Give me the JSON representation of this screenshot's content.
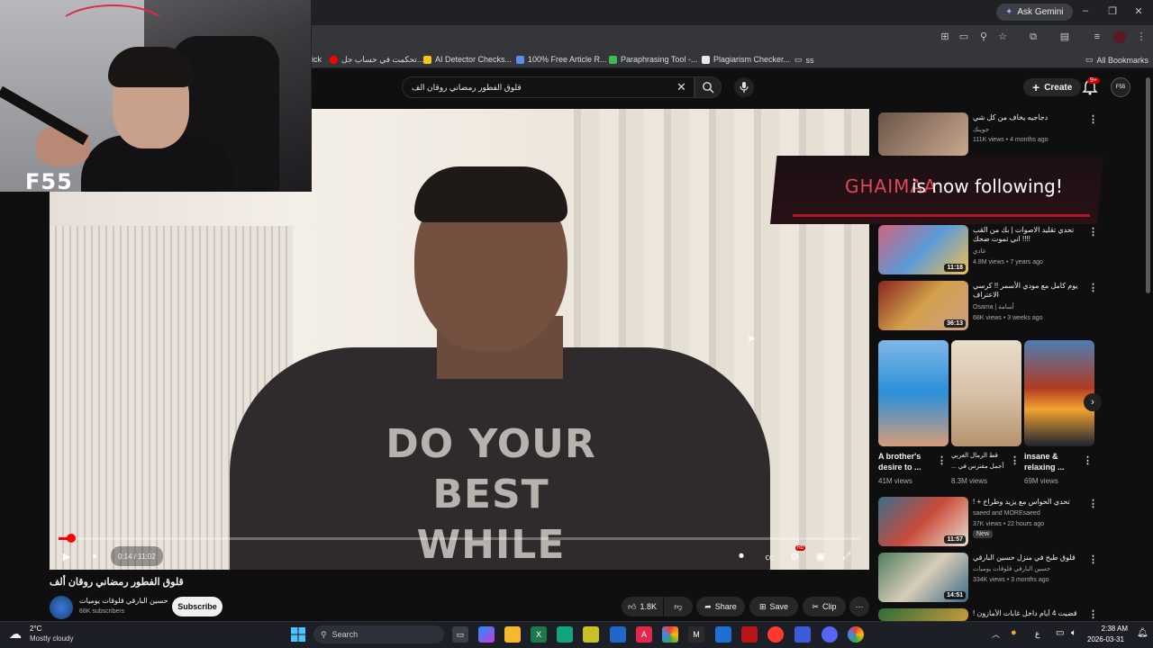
{
  "browser": {
    "ask_gemini": "Ask Gemini",
    "bookmarks": [
      {
        "label": "ick",
        "color": "#202124"
      },
      {
        "label": "تحكمت في حساب جل...",
        "color": "#ff0000"
      },
      {
        "label": "AI Detector Checks...",
        "color": "#f5c518"
      },
      {
        "label": "100% Free Article R...",
        "color": "#5b8def"
      },
      {
        "label": "Paraphrasing Tool -...",
        "color": "#3cba54"
      },
      {
        "label": "Plagiarism Checker...",
        "color": "#e8eaed"
      },
      {
        "label": "ss",
        "color": "#9aa0a6"
      }
    ],
    "all_bookmarks": "All Bookmarks"
  },
  "youtube": {
    "search_query": "قلوق الفطور رمضاني روقان الف",
    "create_label": "Create",
    "notification_count": "9+",
    "avatar_text": "F55"
  },
  "video": {
    "title": "قلوق الفطور رمضاني روقان ألف",
    "time": "0:14 / 11:02",
    "progress": 0.02,
    "shirt_text": [
      "DO YOUR",
      "BEST",
      "WHILE"
    ],
    "channel_name": "حسين البارقي قلوقات يوميات",
    "subscribers": "68K subscribers",
    "subscribe_label": "Subscribe",
    "likes": "1.8K",
    "share_label": "Share",
    "save_label": "Save",
    "clip_label": "Clip"
  },
  "follow_alert": {
    "name": "GHAIMAA",
    "text": "is now following!"
  },
  "sidebar": {
    "videos": [
      {
        "title": "دجاجيه يخاف من كل شي",
        "channel": "جوينك",
        "meta": "111K views • 4 months ago",
        "duration": "",
        "color": "#6a5548"
      },
      {
        "title": "تحدي تقليد الاصوات | بك من القب !!!! اني تموت ضحك",
        "channel": "عادي",
        "meta": "4.8M views • 7 years ago",
        "duration": "11:18",
        "color": "#d1637d"
      },
      {
        "title": "يوم كامل مع مودي الأسمر !! كرسي الاعتراف",
        "channel": "Osama | أسامة",
        "meta": "68K views • 3 weeks ago",
        "duration": "36:13",
        "color": "#8a2520"
      },
      {
        "title": "تحدي الحواس مع يزيد وطراخ + !",
        "channel": "saeed and MOREsaeed",
        "meta": "37K views • 22 hours ago",
        "duration": "11:57",
        "color": "#3a6e8c"
      },
      {
        "title": "قلوق طبخ في منزل حسين البارقي",
        "channel": "حسين البارقي قلوقات يوميات",
        "meta": "334K views • 3 months ago",
        "duration": "14:51",
        "color": "#4f7d5f"
      },
      {
        "title": "قضيت 4 أيام داخل غابات الأمازون !",
        "channel": "",
        "meta": "",
        "duration": "",
        "color": "#2e6d3a"
      }
    ],
    "new_badge": "New",
    "shorts": [
      {
        "title": "A brother's desire to ...",
        "views": "41M views",
        "color": "#2b8fd8"
      },
      {
        "title": "قط الرمال العربي أجمل مفترس في ...",
        "views": "8.3M views",
        "color": "#d8c2a8"
      },
      {
        "title": "insane & relaxing ...",
        "views": "69M views",
        "color": "#b03b24"
      }
    ]
  },
  "taskbar": {
    "temperature": "2°C",
    "weather": "Mostly cloudy",
    "search_placeholder": "Search",
    "time": "2:38 AM",
    "date": "2026-03-31",
    "lang": "ع"
  },
  "webcam": {
    "logo": "F55"
  }
}
